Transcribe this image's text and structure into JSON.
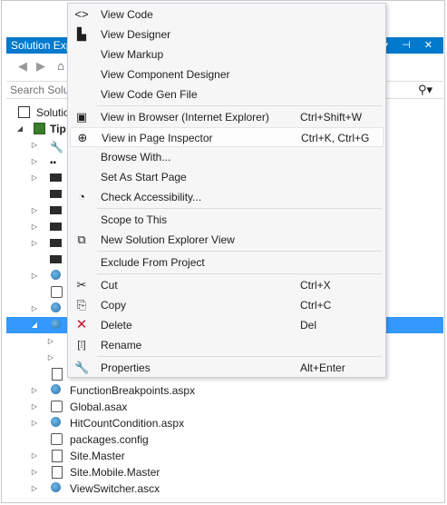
{
  "pane": {
    "title": "Solution Explorer",
    "title_visible": "Solution Exp",
    "title_controls": "▾ ⊣ ✕",
    "search_placeholder": "Search Solu",
    "search_icon": "search-icon"
  },
  "tree": {
    "solution_label": "Solutio",
    "project_label": "Tip",
    "rows": [
      {
        "label": "FunctionBreakpoints.aspx",
        "icon": "web-file-icon"
      },
      {
        "label": "Global.asax",
        "icon": "global-asax-icon"
      },
      {
        "label": "HitCountCondition.aspx",
        "icon": "web-file-icon"
      },
      {
        "label": "packages.config",
        "icon": "config-file-icon"
      },
      {
        "label": "Site.Master",
        "icon": "master-page-icon"
      },
      {
        "label": "Site.Mobile.Master",
        "icon": "master-page-icon"
      },
      {
        "label": "ViewSwitcher.ascx",
        "icon": "user-control-icon"
      }
    ]
  },
  "menu": {
    "items": [
      {
        "label": "View Code",
        "shortcut": "",
        "icon": "code-icon"
      },
      {
        "label": "View Designer",
        "shortcut": "",
        "icon": "designer-icon"
      },
      {
        "label": "View Markup",
        "shortcut": "",
        "icon": ""
      },
      {
        "label": "View Component Designer",
        "shortcut": "",
        "icon": ""
      },
      {
        "label": "View Code Gen File",
        "shortcut": "",
        "icon": ""
      },
      {
        "label": "View in Browser (Internet Explorer)",
        "shortcut": "Ctrl+Shift+W",
        "icon": "browser-icon"
      },
      {
        "label": "View in Page Inspector",
        "shortcut": "Ctrl+K, Ctrl+G",
        "icon": "page-inspector-icon"
      },
      {
        "label": "Browse With...",
        "shortcut": "",
        "icon": ""
      },
      {
        "label": "Set As Start Page",
        "shortcut": "",
        "icon": ""
      },
      {
        "label": "Check Accessibility...",
        "shortcut": "",
        "icon": "accessibility-icon"
      },
      {
        "label": "Scope to This",
        "shortcut": "",
        "icon": ""
      },
      {
        "label": "New Solution Explorer View",
        "shortcut": "",
        "icon": "new-view-icon"
      },
      {
        "label": "Exclude From Project",
        "shortcut": "",
        "icon": ""
      },
      {
        "label": "Cut",
        "shortcut": "Ctrl+X",
        "icon": "cut-icon"
      },
      {
        "label": "Copy",
        "shortcut": "Ctrl+C",
        "icon": "copy-icon"
      },
      {
        "label": "Delete",
        "shortcut": "Del",
        "icon": "delete-icon"
      },
      {
        "label": "Rename",
        "shortcut": "",
        "icon": "rename-icon"
      },
      {
        "label": "Properties",
        "shortcut": "Alt+Enter",
        "icon": "properties-icon"
      }
    ]
  },
  "colors": {
    "accent": "#007acc",
    "selection": "#3399ff",
    "menu_bg": "#f6f6f6",
    "delete_red": "#c8102e"
  }
}
